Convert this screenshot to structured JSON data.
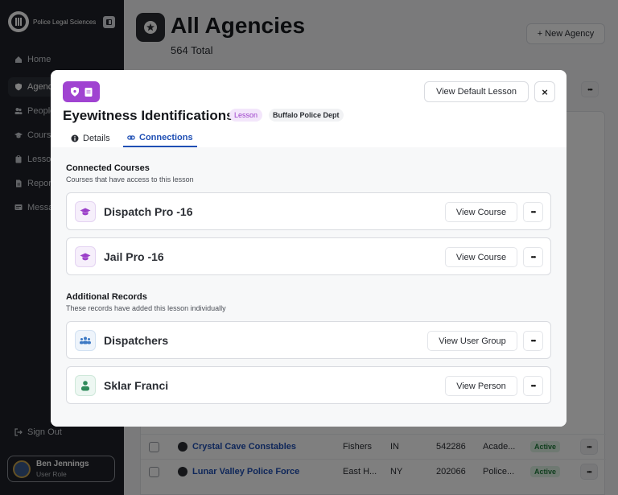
{
  "sidebar": {
    "brand_name": "Police Legal Sciences",
    "nav": [
      {
        "label": "Home",
        "icon": "home-icon"
      },
      {
        "label": "Agencies",
        "icon": "shield-icon"
      },
      {
        "label": "People",
        "icon": "people-icon"
      },
      {
        "label": "Courses",
        "icon": "graduation-cap-icon"
      },
      {
        "label": "Lessons",
        "icon": "clipboard-icon"
      },
      {
        "label": "Reports",
        "icon": "document-icon"
      },
      {
        "label": "Messages",
        "icon": "message-icon"
      }
    ],
    "sign_out": "Sign Out",
    "user": {
      "name": "Ben Jennings",
      "role": "User Role"
    }
  },
  "main": {
    "title": "All Agencies",
    "subtitle": "564 Total",
    "new_button": "+ New Agency",
    "rows": [
      {
        "name": "Crystal Cave Constables",
        "city": "Fishers",
        "state": "IN",
        "code": "542286",
        "type": "Acade...",
        "status": "Active"
      },
      {
        "name": "Lunar Valley Police Force",
        "city": "East H...",
        "state": "NY",
        "code": "202066",
        "type": "Police...",
        "status": "Active"
      }
    ]
  },
  "modal": {
    "title": "Eyewitness Identifications",
    "type_badge": "Lesson",
    "dept_badge": "Buffalo Police Dept",
    "view_default_button": "View Default Lesson",
    "close_glyph": "×",
    "tabs": [
      {
        "label": "Details",
        "icon": "info-icon"
      },
      {
        "label": "Connections",
        "icon": "link-icon"
      }
    ],
    "connected": {
      "title": "Connected Courses",
      "subtitle": "Courses that have access to this lesson",
      "items": [
        {
          "name": "Dispatch Pro -16",
          "button": "View Course",
          "icon": "graduation-cap-icon"
        },
        {
          "name": "Jail Pro -16",
          "button": "View Course",
          "icon": "graduation-cap-icon"
        }
      ]
    },
    "additional": {
      "title": "Additional Records",
      "subtitle": "These records have added this lesson individually",
      "items": [
        {
          "name": "Dispatchers",
          "button": "View User Group",
          "icon": "user-group-icon"
        },
        {
          "name": "Sklar Franci",
          "button": "View Person",
          "icon": "person-icon"
        }
      ]
    },
    "more_glyph": "•••"
  },
  "colors": {
    "accent_purple": "#a043d1",
    "link_blue": "#1f4fb4",
    "sidebar_bg": "#1e2128",
    "active_green": "#1f7a3a"
  }
}
